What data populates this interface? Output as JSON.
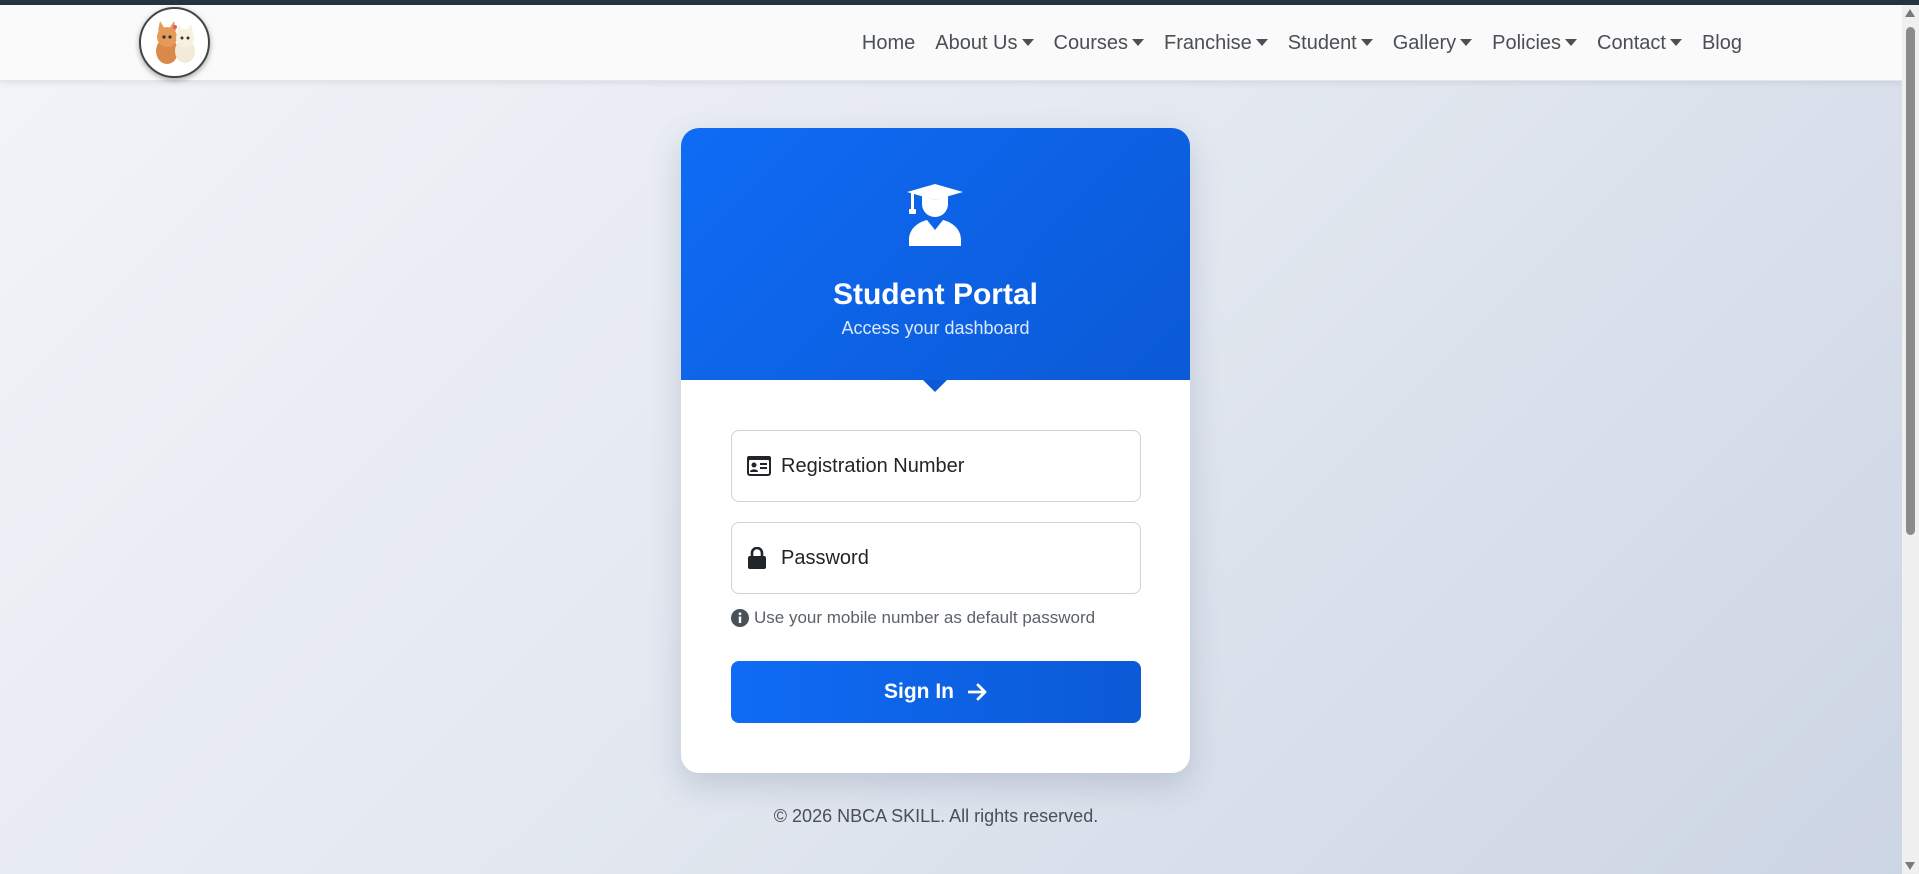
{
  "nav": {
    "logo_alt": "logo",
    "items": [
      {
        "label": "Home",
        "dropdown": false
      },
      {
        "label": "About Us",
        "dropdown": true
      },
      {
        "label": "Courses",
        "dropdown": true
      },
      {
        "label": "Franchise",
        "dropdown": true
      },
      {
        "label": "Student",
        "dropdown": true
      },
      {
        "label": "Gallery",
        "dropdown": true
      },
      {
        "label": "Policies",
        "dropdown": true
      },
      {
        "label": "Contact",
        "dropdown": true
      },
      {
        "label": "Blog",
        "dropdown": false
      }
    ]
  },
  "card": {
    "icon": "user-graduate-icon",
    "title": "Student Portal",
    "subtitle": "Access your dashboard",
    "registration_placeholder": "Registration Number",
    "password_placeholder": "Password",
    "hint": "Use your mobile number as default password",
    "signin_label": "Sign In"
  },
  "footer": {
    "text": "© 2026 NBCA SKILL. All rights reserved."
  },
  "colors": {
    "primary": "#0d6efd",
    "nav_text": "#4a4f55",
    "card_bg": "#ffffff"
  }
}
